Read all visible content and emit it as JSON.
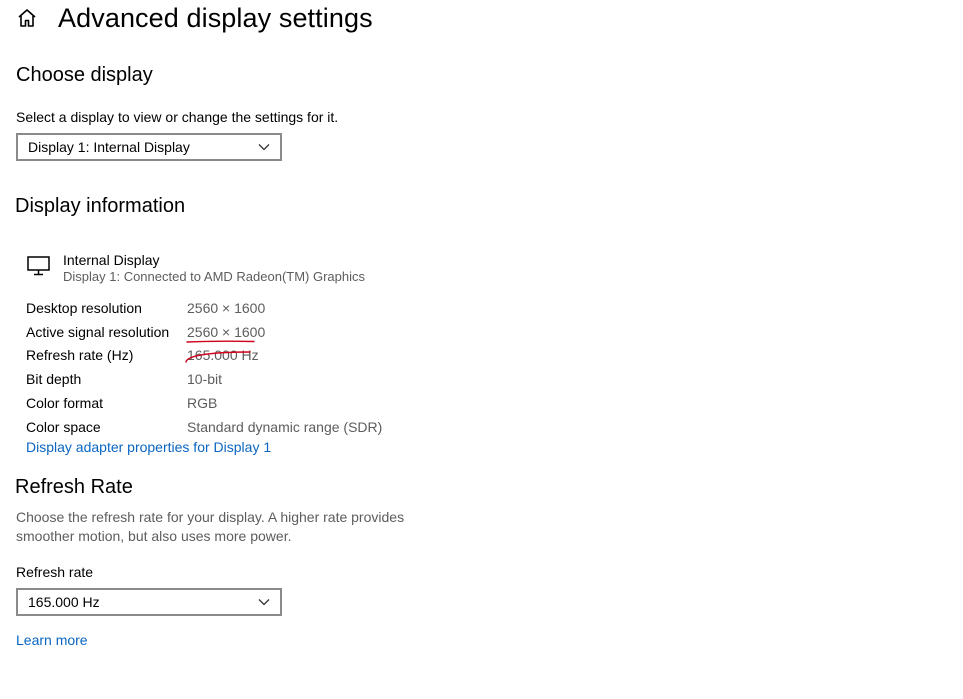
{
  "header": {
    "home_icon": "home-icon",
    "title": "Advanced display settings"
  },
  "choose_display": {
    "title": "Choose display",
    "instruction": "Select a display to view or change the settings for it.",
    "selected": "Display 1: Internal Display"
  },
  "display_information": {
    "title": "Display information",
    "monitor_icon": "monitor-icon",
    "display_name": "Internal Display",
    "display_connection": "Display 1: Connected to AMD Radeon(TM) Graphics",
    "rows": [
      {
        "label": "Desktop resolution",
        "value": "2560 × 1600"
      },
      {
        "label": "Active signal resolution",
        "value": "2560 × 1600"
      },
      {
        "label": "Refresh rate (Hz)",
        "value": "165.000 Hz"
      },
      {
        "label": "Bit depth",
        "value": "10-bit"
      },
      {
        "label": "Color format",
        "value": "RGB"
      },
      {
        "label": "Color space",
        "value": "Standard dynamic range (SDR)"
      }
    ],
    "adapter_link": "Display adapter properties for Display 1"
  },
  "refresh_rate": {
    "title": "Refresh Rate",
    "description": "Choose the refresh rate for your display. A higher rate provides smoother motion, but also uses more power.",
    "field_label": "Refresh rate",
    "selected": "165.000 Hz",
    "learn_more": "Learn more"
  },
  "colors": {
    "link": "#0a66c2",
    "muted_text": "#5d5d5d",
    "annotation": "#d0021b"
  }
}
